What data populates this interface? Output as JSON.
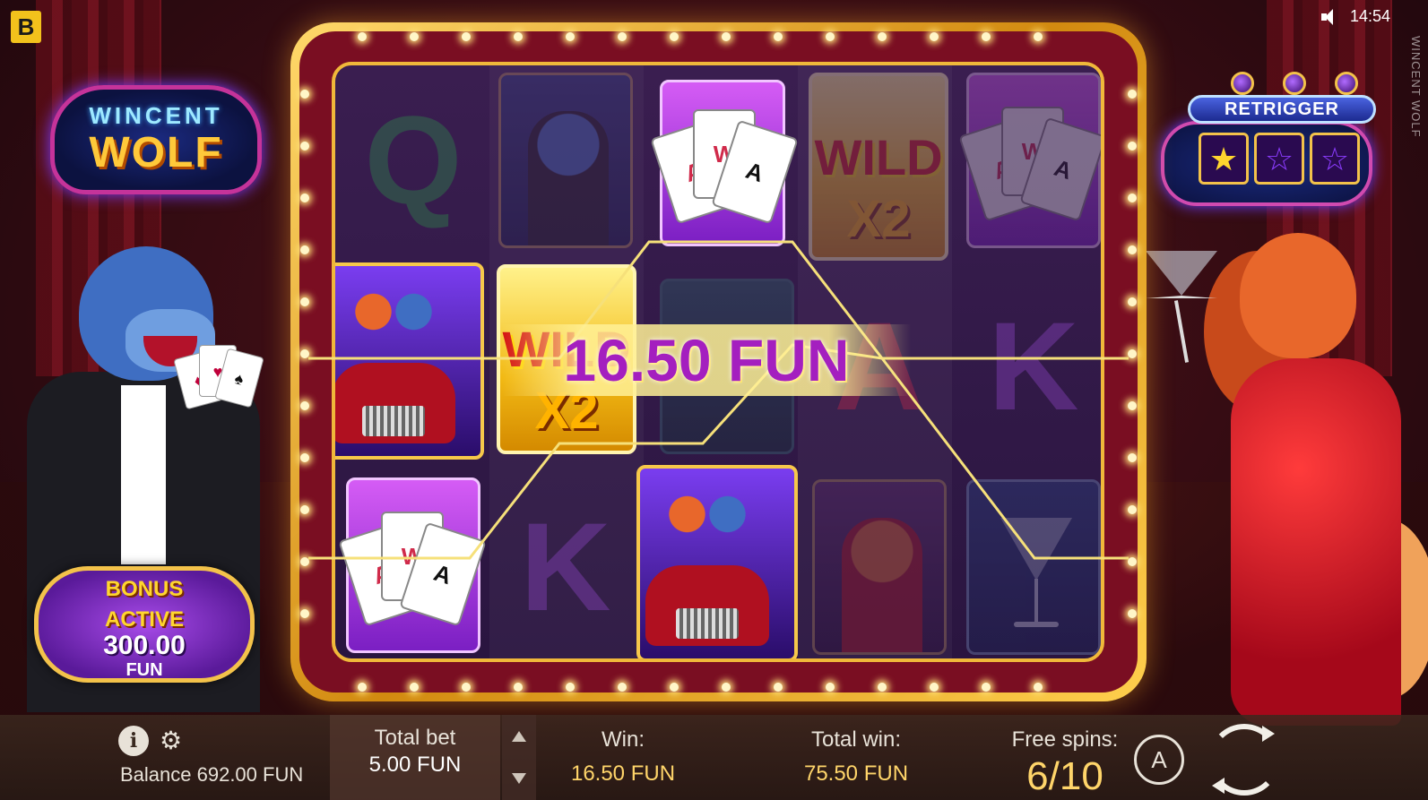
{
  "brand_badge": "B",
  "status": {
    "time": "14:54",
    "vertical_brand": "WINCENT WOLF"
  },
  "logo": {
    "line1": "WINCENT",
    "line2": "WOLF"
  },
  "retrigger": {
    "title": "RETRIGGER",
    "stars": [
      "★",
      "☆",
      "☆"
    ],
    "stars_lit": 1,
    "stars_total": 3
  },
  "reels": {
    "columns": [
      [
        "Q",
        "KING_LIMO",
        "CARDS"
      ],
      [
        "WOLF",
        "WILD x2",
        "K"
      ],
      [
        "CARDS",
        "MONEY",
        "KING_LIMO"
      ],
      [
        "WILD x2",
        "A",
        "FOX"
      ],
      [
        "CARDS",
        "K",
        "MARTINI"
      ]
    ],
    "wild_text": "WILD",
    "wild_multiplier": "X2",
    "letter_q": "Q",
    "letter_k": "K",
    "letter_a": "A",
    "card_labels": [
      "A",
      "W",
      "A"
    ]
  },
  "win_overlay": {
    "amount": "16.50 FUN"
  },
  "bonus": {
    "line1": "BONUS",
    "line2": "ACTIVE",
    "amount": "300.00",
    "currency": "FUN"
  },
  "bottom": {
    "info_label": "i",
    "balance_label": "Balance 692.00 FUN",
    "total_bet_label": "Total bet",
    "total_bet_value": "5.00 FUN",
    "win_label": "Win:",
    "win_value": "16.50 FUN",
    "total_win_label": "Total win:",
    "total_win_value": "75.50 FUN",
    "free_spins_label": "Free spins:",
    "free_spins_value": "6/10",
    "auto_label": "A"
  },
  "colors": {
    "frame_gold": "#f0b83a",
    "win_text": "#a41fbf",
    "value_gold": "#ffd56a"
  },
  "icons": [
    "speaker-icon",
    "info-icon",
    "gear-icon",
    "autoplay-icon",
    "spin-icon",
    "star-icon"
  ]
}
